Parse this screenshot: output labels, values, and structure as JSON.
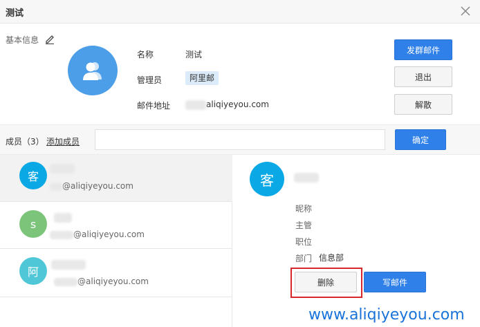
{
  "dialog": {
    "title": "测试"
  },
  "info": {
    "section_label": "基本信息",
    "name_label": "名称",
    "name_value": "测试",
    "admin_label": "管理员",
    "admin_value": "阿里邮",
    "email_label": "邮件地址",
    "email_value": "aliqiyeyou.com"
  },
  "actions": {
    "send_group_mail": "发群邮件",
    "quit": "退出",
    "dissolve": "解散",
    "confirm": "确定"
  },
  "member_bar": {
    "count_label": "成员（3）",
    "add_link": "添加成员"
  },
  "members": [
    {
      "avatar_char": "客",
      "color": "#0aa9e6",
      "email_suffix": "@aliqiyeyou.com"
    },
    {
      "avatar_char": "s",
      "color": "#7cc47a",
      "email_suffix": "@aliqiyeyou.com"
    },
    {
      "avatar_char": "阿",
      "color": "#4fc7d6",
      "email_suffix": "@aliqiyeyou.com"
    }
  ],
  "detail": {
    "avatar_char": "客",
    "nickname_label": "昵称",
    "supervisor_label": "主管",
    "position_label": "职位",
    "department_label": "部门",
    "department_value": "信息部",
    "delete_button": "删除",
    "write_mail_button": "写邮件"
  },
  "watermark": "www.aliqiyeyou.com",
  "colors": {
    "primary": "#2f80e8",
    "highlight": "#d9262c",
    "avatar_group": "#4c9ee8"
  }
}
